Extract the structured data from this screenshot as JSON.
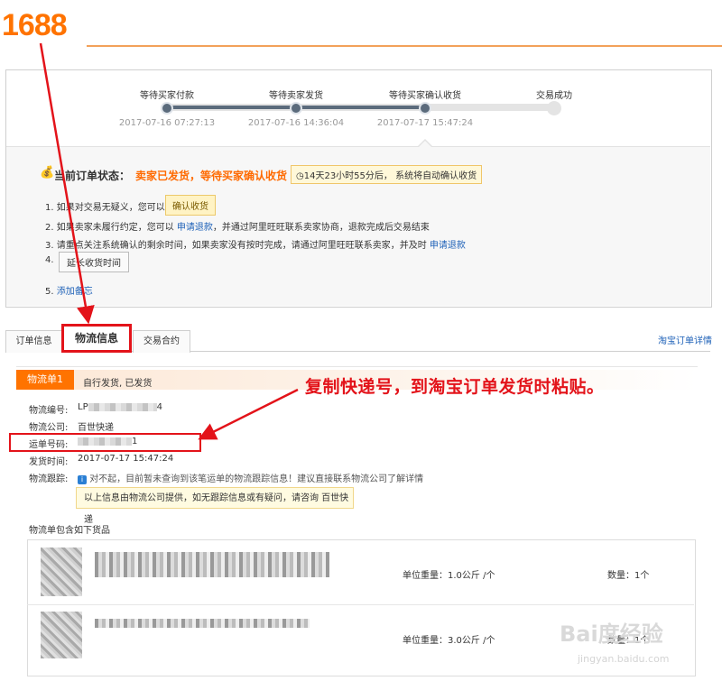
{
  "logo": "1688",
  "steps": [
    {
      "label": "等待买家付款",
      "time": "2017-07-16 07:27:13"
    },
    {
      "label": "等待卖家发货",
      "time": "2017-07-16 14:36:04"
    },
    {
      "label": "等待买家确认收货",
      "time": "2017-07-17 15:47:24"
    },
    {
      "label": "交易成功",
      "time": ""
    }
  ],
  "status": {
    "title": "当前订单状态：",
    "value": "卖家已发货，等待买家确认收货",
    "countdown": "14天23小时55分后，",
    "countdown_tail": "系统将自动确认收货"
  },
  "instructions": {
    "i1_num": "1.",
    "i1_text": "如果对交易无疑义，您可以",
    "i1_btn": "确认收货",
    "i2_num": "2.",
    "i2_a": "如果卖家未履行约定，您可以",
    "i2_link": "申请退款",
    "i2_b": "，并通过阿里旺旺联系卖家协商，退款完成后交易结束",
    "i3_num": "3.",
    "i3_a": "请重点关注系统确认的剩余时间，如果卖家没有按时完成，请通过阿里旺旺联系卖家，并及时",
    "i3_link": "申请退款",
    "i4_num": "4.",
    "i4_btn": "延长收货时间",
    "i5_num": "5.",
    "i5_link": "添加备忘"
  },
  "tabs": {
    "order_info": "订单信息",
    "logistics": "物流信息",
    "contract": "交易合约",
    "taobao_link": "淘宝订单详情"
  },
  "logistics": {
    "badge": "物流单1",
    "header_text": "自行发货, 已发货",
    "no_label": "物流编号:",
    "no_prefix": "LP",
    "no_suffix": "4",
    "company_label": "物流公司:",
    "company": "百世快递",
    "waybill_label": "运单号码:",
    "waybill_suffix": "1",
    "ship_time_label": "发货时间:",
    "ship_time": "2017-07-17 15:47:24",
    "track_label": "物流跟踪:",
    "track_msg": "对不起，目前暂未查询到该笔运单的物流跟踪信息！建议直接联系物流公司了解详情",
    "notice": "以上信息由物流公司提供，如无跟踪信息或有疑问，请咨询 百世快递",
    "goods_title": "物流单包含如下货品",
    "goods": [
      {
        "weight": "单位重量：1.0公斤 /个",
        "qty": "数量：1个"
      },
      {
        "weight": "单位重量：3.0公斤 /个",
        "qty": "数量：1个"
      }
    ]
  },
  "annotation": "复制快递号，到淘宝订单发货时粘贴。",
  "watermark": "Bai度经验",
  "watermark_sub": "jingyan.baidu.com",
  "colors": {
    "accent": "#ff7300",
    "annotation_red": "#e3131a",
    "link": "#1f62b8"
  }
}
